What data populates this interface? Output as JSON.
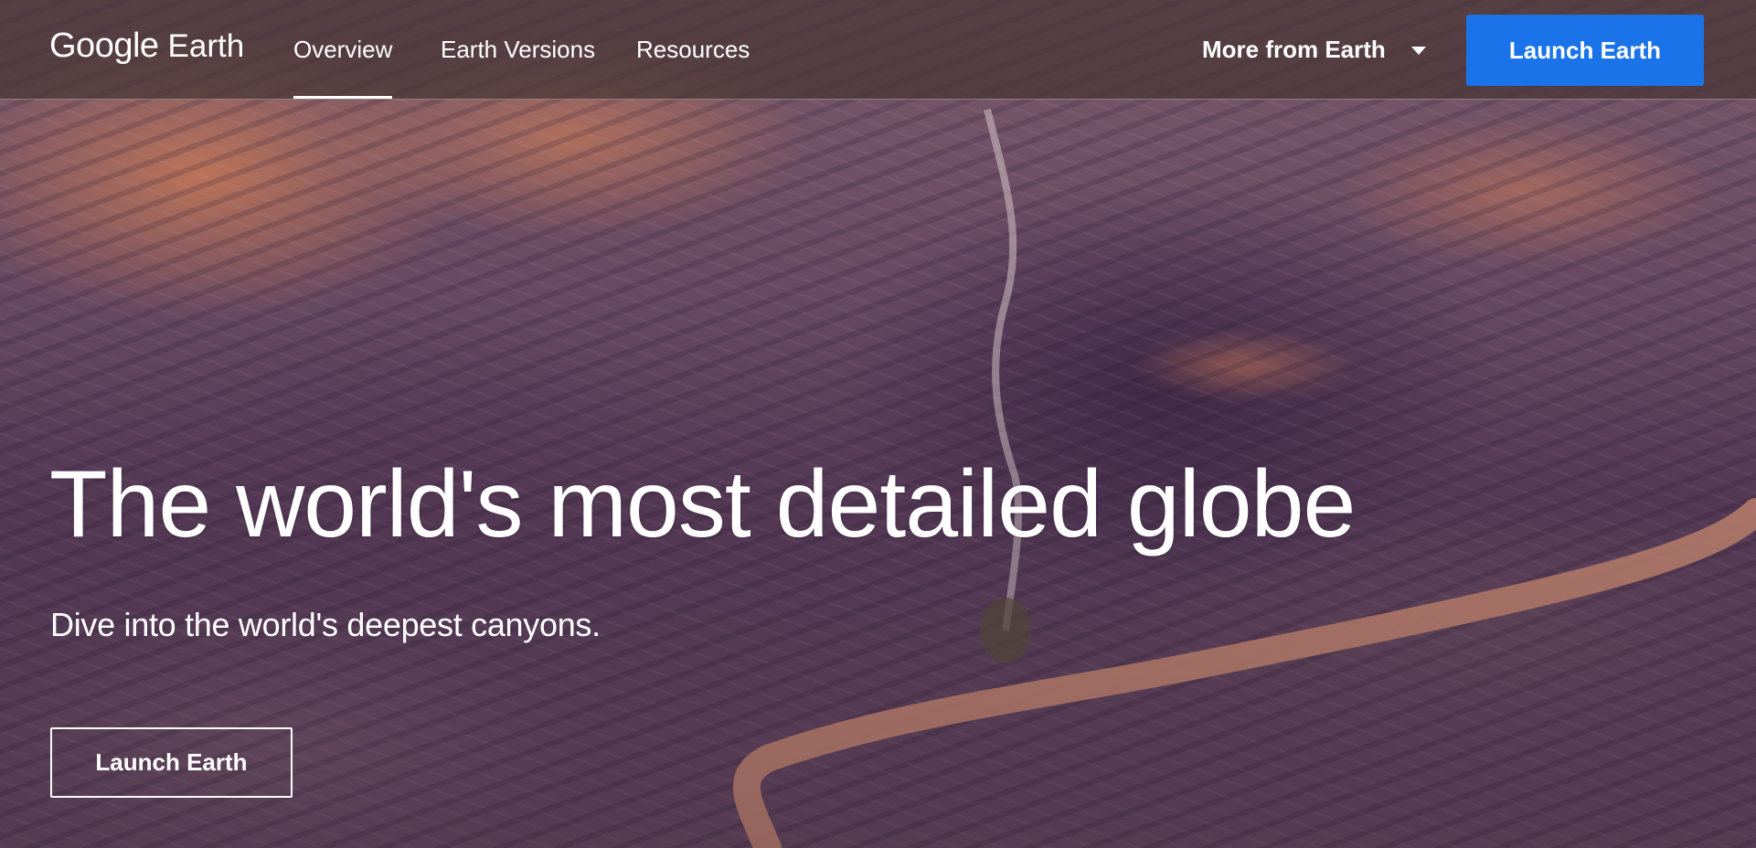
{
  "header": {
    "logo": {
      "google": "Google",
      "earth": "Earth"
    },
    "nav": [
      {
        "label": "Overview",
        "active": true
      },
      {
        "label": "Earth Versions",
        "active": false
      },
      {
        "label": "Resources",
        "active": false
      }
    ],
    "more_menu": {
      "label": "More from Earth",
      "icon": "caret-down-icon"
    },
    "launch_button": {
      "label": "Launch Earth"
    }
  },
  "hero": {
    "title": "The world's most detailed globe",
    "subtitle": "Dive into the world's deepest canyons.",
    "launch_button": {
      "label": "Launch Earth"
    }
  },
  "colors": {
    "accent": "#1a73e8",
    "text": "#ffffff",
    "topbar": "#463434"
  }
}
